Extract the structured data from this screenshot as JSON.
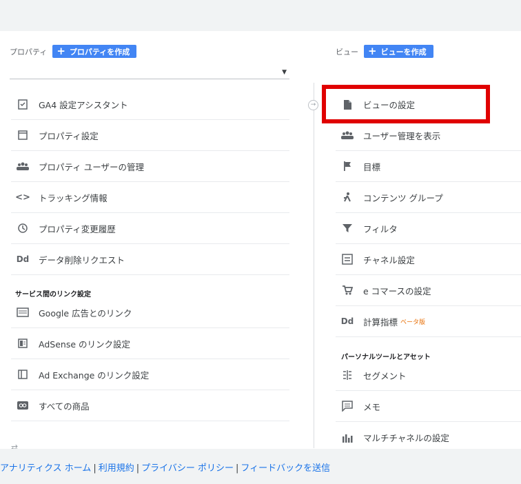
{
  "property": {
    "header_label": "プロパティ",
    "create_label": "プロパティを作成",
    "items": [
      {
        "label": "GA4 設定アシスタント",
        "icon": "clipboard-check-icon"
      },
      {
        "label": "プロパティ設定",
        "icon": "window-icon"
      },
      {
        "label": "プロパティ ユーザーの管理",
        "icon": "people-icon"
      },
      {
        "label": "トラッキング情報",
        "icon": "code-icon"
      },
      {
        "label": "プロパティ変更履歴",
        "icon": "history-icon"
      },
      {
        "label": "データ削除リクエスト",
        "icon": "dd-icon"
      }
    ],
    "section_title": "サービス間のリンク設定",
    "link_items": [
      {
        "label": "Google 広告とのリンク",
        "icon": "ads-icon"
      },
      {
        "label": "AdSense のリンク設定",
        "icon": "adsense-icon"
      },
      {
        "label": "Ad Exchange のリンク設定",
        "icon": "adexchange-icon"
      },
      {
        "label": "すべての商品",
        "icon": "link-icon"
      }
    ]
  },
  "view": {
    "header_label": "ビュー",
    "create_label": "ビューを作成",
    "items": [
      {
        "label": "ビューの設定",
        "icon": "document-icon"
      },
      {
        "label": "ユーザー管理を表示",
        "icon": "people-icon"
      },
      {
        "label": "目標",
        "icon": "flag-icon"
      },
      {
        "label": "コンテンツ グループ",
        "icon": "walk-icon"
      },
      {
        "label": "フィルタ",
        "icon": "filter-icon"
      },
      {
        "label": "チャネル設定",
        "icon": "channel-icon"
      },
      {
        "label": "e コマースの設定",
        "icon": "cart-icon"
      },
      {
        "label": "計算指標",
        "icon": "dd-icon",
        "badge": "ベータ版"
      }
    ],
    "section_title": "パーソナルツールとアセット",
    "personal_items": [
      {
        "label": "セグメント",
        "icon": "segment-icon"
      },
      {
        "label": "メモ",
        "icon": "comment-icon"
      },
      {
        "label": "マルチチャネルの設定",
        "icon": "bar-chart-icon"
      }
    ]
  },
  "footer": {
    "links": [
      "アナリティクス ホーム",
      "利用規約",
      "プライバシー ポリシー",
      "フィードバックを送信"
    ]
  }
}
